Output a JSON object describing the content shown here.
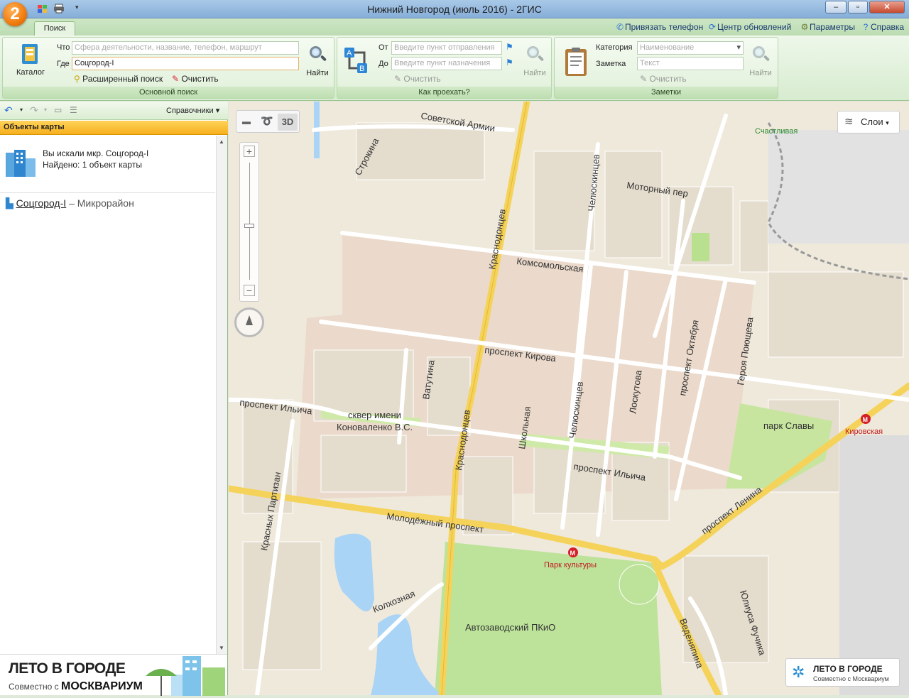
{
  "window": {
    "title": "Нижний Новгород (июль 2016) - 2ГИС",
    "logo": "2"
  },
  "tabs": {
    "search": "Поиск"
  },
  "toplinks": {
    "phone": "Привязать телефон",
    "updates": "Центр обновлений",
    "params": "Параметры",
    "help": "Справка"
  },
  "search": {
    "catalog": "Каталог",
    "what_label": "Что",
    "what_placeholder": "Сфера деятельности, название, телефон, маршрут",
    "where_label": "Где",
    "where_value": "Соцгород-I",
    "find": "Найти",
    "advanced": "Расширенный поиск",
    "clear": "Очистить",
    "group": "Основной поиск"
  },
  "route": {
    "from_label": "От",
    "from_placeholder": "Введите пункт отправления",
    "to_label": "До",
    "to_placeholder": "Введите пункт назначения",
    "find": "Найти",
    "clear": "Очистить",
    "group": "Как проехать?"
  },
  "notes": {
    "category_label": "Категория",
    "category_placeholder": "Наименование",
    "note_label": "Заметка",
    "note_placeholder": "Текст",
    "find": "Найти",
    "clear": "Очистить",
    "group": "Заметки"
  },
  "panel": {
    "toolbar_right": "Справочники",
    "header": "Объекты карты",
    "searched": "Вы искали мкр. Соцгород-I",
    "found": "Найдено: 1 объект карты",
    "result_name": "Соцгород-I",
    "result_type": "– Микрорайон",
    "banner_title": "ЛЕТО В ГОРОДЕ",
    "banner_sub": "Совместно с",
    "banner_brand": "МОСКВАРИУМ"
  },
  "map": {
    "btn_3d": "3D",
    "layers": "Слои",
    "promo_title": "ЛЕТО В ГОРОДЕ",
    "promo_sub": "Совместно с Москвариум",
    "streets": {
      "sovetskoy_armii": "Советской Армии",
      "strokina": "Строкина",
      "krasnodontsev": "Краснодонцев",
      "chelyuskintsev": "Челюскинцев",
      "motorny": "Моторный пер",
      "komsomolskaya": "Комсомольская",
      "kirova": "проспект Кирова",
      "vatutina": "Ватутина",
      "ilyicha_w": "проспект Ильича",
      "ilyicha_e": "проспект Ильича",
      "skver1": "сквер имени",
      "skver2": "Коноваленко В.С.",
      "shkolnaya": "Школьная",
      "chelyuskintsev2": "Челюскинцев",
      "loskutova": "Лоскутова",
      "oktyabrya": "проспект Октября",
      "poyushcheva": "Героя Поющева",
      "partizan": "Красных Партизан",
      "molodezhny": "Молодёжный проспект",
      "lenina": "проспект Ленина",
      "kolkhoznaya": "Колхозная",
      "vedenyapina": "Веденяпина",
      "fuchika": "Юлиуса Фучика",
      "krasnodontsev2": "Краснодонцев"
    },
    "places": {
      "schastlivaya": "Счастливая",
      "park_slavy": "парк Славы",
      "kirovskaya": "Кировская",
      "park_kultury": "Парк культуры",
      "pkio": "Автозаводский ПКиО"
    }
  }
}
